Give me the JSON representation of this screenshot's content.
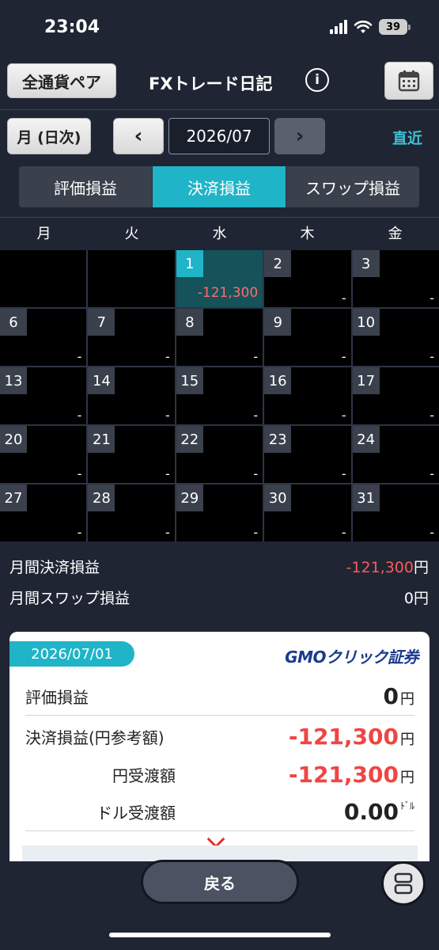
{
  "status": {
    "time": "23:04",
    "battery": "39"
  },
  "header": {
    "pair_button": "全通貨ペア",
    "title": "FXトレード日記",
    "info_icon": "info-icon",
    "calendar_icon": "calendar-icon"
  },
  "nav": {
    "mode_button": "月 (日次)",
    "prev": "‹",
    "month": "2026/07",
    "next": "›",
    "recent": "直近"
  },
  "tabs": [
    {
      "label": "評価損益",
      "active": false
    },
    {
      "label": "決済損益",
      "active": true
    },
    {
      "label": "スワップ損益",
      "active": false
    }
  ],
  "weekdays": [
    "月",
    "火",
    "水",
    "木",
    "金"
  ],
  "calendar": [
    {
      "day": "",
      "value": ""
    },
    {
      "day": "",
      "value": ""
    },
    {
      "day": "1",
      "value": "-121,300"
    },
    {
      "day": "2",
      "value": "-"
    },
    {
      "day": "3",
      "value": "-"
    },
    {
      "day": "6",
      "value": "-"
    },
    {
      "day": "7",
      "value": "-"
    },
    {
      "day": "8",
      "value": "-"
    },
    {
      "day": "9",
      "value": "-"
    },
    {
      "day": "10",
      "value": "-"
    },
    {
      "day": "13",
      "value": "-"
    },
    {
      "day": "14",
      "value": "-"
    },
    {
      "day": "15",
      "value": "-"
    },
    {
      "day": "16",
      "value": "-"
    },
    {
      "day": "17",
      "value": "-"
    },
    {
      "day": "20",
      "value": "-"
    },
    {
      "day": "21",
      "value": "-"
    },
    {
      "day": "22",
      "value": "-"
    },
    {
      "day": "23",
      "value": "-"
    },
    {
      "day": "24",
      "value": "-"
    },
    {
      "day": "27",
      "value": "-"
    },
    {
      "day": "28",
      "value": "-"
    },
    {
      "day": "29",
      "value": "-"
    },
    {
      "day": "30",
      "value": "-"
    },
    {
      "day": "31",
      "value": "-"
    }
  ],
  "summary": {
    "settled_label": "月間決済損益",
    "settled_value": "-121,300",
    "settled_unit": "円",
    "swap_label": "月間スワップ損益",
    "swap_value": "0",
    "swap_unit": "円"
  },
  "detail": {
    "date": "2026/07/01",
    "logo": "GMOクリック証券",
    "rows": [
      {
        "label": "評価損益",
        "value": "0",
        "unit": "円"
      },
      {
        "label": "決済損益(円参考額)",
        "value": "-121,300",
        "unit": "円"
      },
      {
        "label": "円受渡額",
        "value": "-121,300",
        "unit": "円"
      },
      {
        "label": "ドル受渡額",
        "value": "0.00",
        "unit": "ﾄﾞﾙ"
      }
    ]
  },
  "bottom": {
    "back_button": "戻る"
  },
  "colors": {
    "accent": "#1fb4c8",
    "negative": "#ff5a5a",
    "background": "#1f2533"
  }
}
